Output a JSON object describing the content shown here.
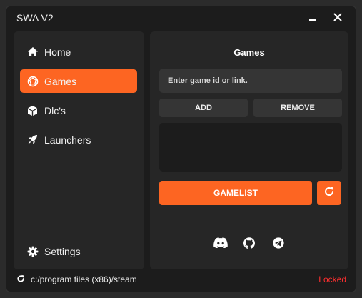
{
  "window": {
    "title": "SWA V2",
    "controls": [
      "minimize-icon",
      "close-icon"
    ]
  },
  "sidebar": {
    "items": [
      {
        "label": "Home",
        "icon": "home-icon",
        "active": false
      },
      {
        "label": "Games",
        "icon": "dice-icon",
        "active": true
      },
      {
        "label": "Dlc's",
        "icon": "cube-icon",
        "active": false
      },
      {
        "label": "Launchers",
        "icon": "rocket-icon",
        "active": false
      }
    ],
    "settings": {
      "label": "Settings",
      "icon": "gear-icon"
    }
  },
  "main": {
    "title": "Games",
    "input": {
      "placeholder": "Enter game id or link.",
      "value": ""
    },
    "add_label": "ADD",
    "remove_label": "REMOVE",
    "gamelist_label": "GAMELIST",
    "refresh_icon": "refresh-icon",
    "social_icons": [
      "discord-icon",
      "github-icon",
      "telegram-icon"
    ]
  },
  "footer": {
    "icon": "refresh-icon",
    "path": "c:/program files (x86)/steam",
    "status": "Locked"
  },
  "colors": {
    "accent": "#fd6522",
    "background": "#1c1c1c",
    "panel": "#262626",
    "control": "#353535",
    "status_locked": "#ff2f2f"
  }
}
